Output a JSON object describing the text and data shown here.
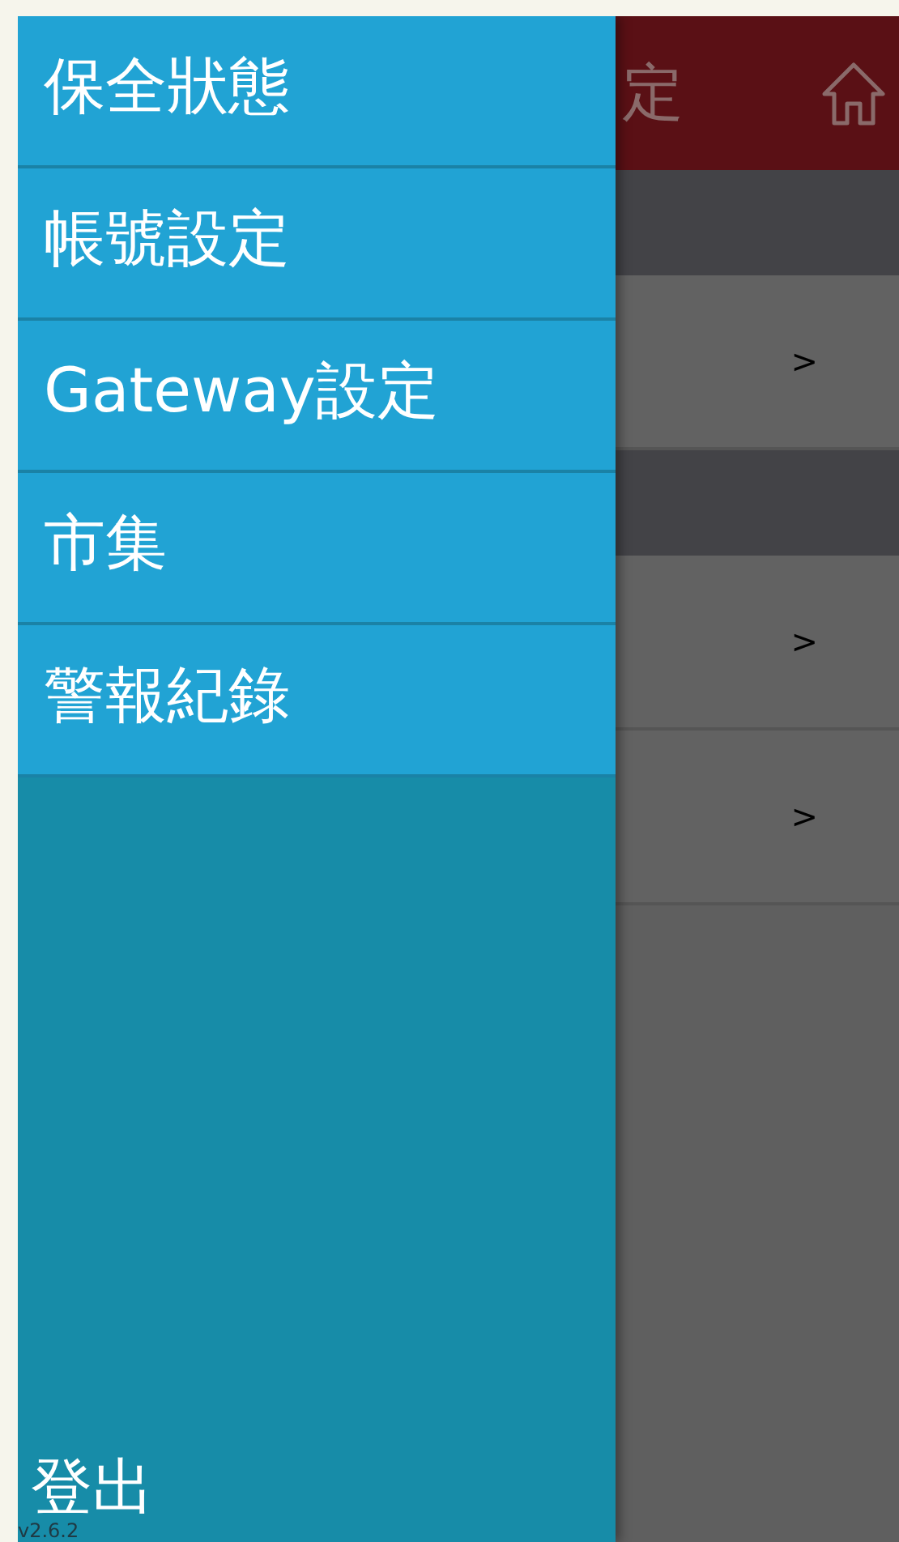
{
  "app": {
    "header_title": "定",
    "sections": [
      {
        "kind": "header"
      },
      {
        "kind": "row",
        "arrow": ">"
      },
      {
        "kind": "header"
      },
      {
        "kind": "row",
        "arrow": ">"
      },
      {
        "kind": "row",
        "arrow": ">"
      }
    ]
  },
  "drawer": {
    "items": [
      {
        "label": "保全狀態"
      },
      {
        "label": "帳號設定"
      },
      {
        "label": "Gateway設定"
      },
      {
        "label": "市集"
      },
      {
        "label": "警報紀錄"
      }
    ],
    "logout": "登出",
    "version": "v2.6.2"
  }
}
